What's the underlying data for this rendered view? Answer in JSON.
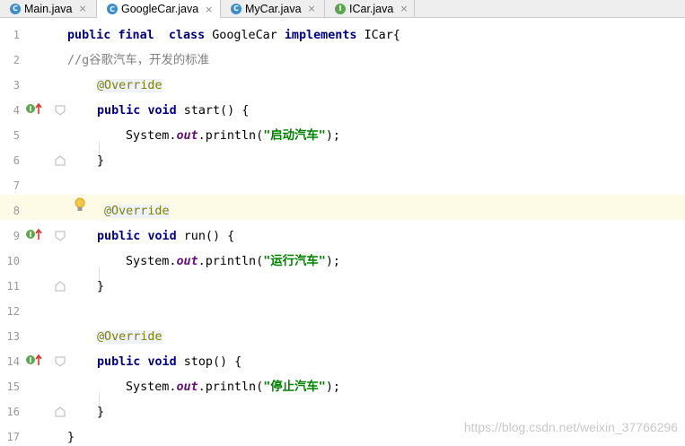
{
  "tabs": [
    {
      "name": "Main.java",
      "icon": "C",
      "type": "class",
      "active": false
    },
    {
      "name": "GoogleCar.java",
      "icon": "C",
      "type": "class",
      "active": true
    },
    {
      "name": "MyCar.java",
      "icon": "C",
      "type": "class",
      "active": false
    },
    {
      "name": "ICar.java",
      "icon": "I",
      "type": "interface",
      "active": false
    }
  ],
  "close_glyph": "×",
  "line_numbers": [
    "1",
    "2",
    "3",
    "4",
    "5",
    "6",
    "7",
    "8",
    "9",
    "10",
    "11",
    "12",
    "13",
    "14",
    "15",
    "16",
    "17"
  ],
  "code": {
    "l1_public": "public",
    "l1_final": "final",
    "l1_class": "class",
    "l1_name": "GoogleCar",
    "l1_implements": "implements",
    "l1_iface": "ICar{",
    "l2_comment": "//g谷歌汽车，开发的标准",
    "annotation": "@Override",
    "m1_public": "public",
    "m1_void": "void",
    "m1_sig": "start() {",
    "m2_public": "public",
    "m2_void": "void",
    "m2_sig": "run() {",
    "m3_public": "public",
    "m3_void": "void",
    "m3_sig": "stop() {",
    "sys": "System.",
    "out": "out",
    ".println(": "println(",
    "s1": "\"启动汽车\"",
    "s2": "\"运行汽车\"",
    "s3": "\"停止汽车\"",
    "semi": ");",
    "close_brace": "}"
  },
  "colors": {
    "keyword": "#000080",
    "comment": "#808080",
    "annotation": "#808000",
    "string": "#008000",
    "field": "#660e7a",
    "highlight": "#fdfbe6"
  },
  "icons": {
    "implements_marker": "implements-method-icon",
    "intention": "lightbulb-icon",
    "fold": "fold-marker-icon"
  },
  "watermark": "https://blog.csdn.net/weixin_37766296"
}
